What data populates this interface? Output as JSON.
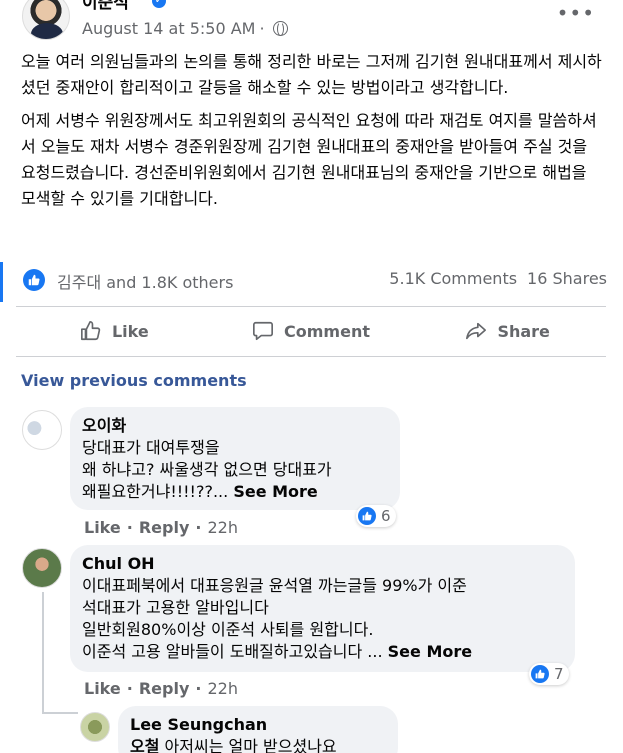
{
  "post": {
    "author": "이준석",
    "verified_mark": "✓",
    "timestamp": "August 14 at 5:50 AM",
    "separator": "·",
    "more_label": "•••",
    "paragraphs": [
      "오늘 여러 의원님들과의 논의를 통해 정리한 바로는 그저께 김기현 원내대표께서 제시하셨던 중재안이 합리적이고 갈등을 해소할 수 있는 방법이라고 생각합니다.",
      "어제 서병수 위원장께서도 최고위원회의 공식적인 요청에 따라 재검토 여지를 말씀하셔서 오늘도 재차 서병수 경준위원장께 김기현 원내대표의 중재안을 받아들여 주실 것을 요청드렸습니다. 경선준비위원회에서 김기현 원내대표님의 중재안을 기반으로 해법을 모색할 수 있기를 기대합니다."
    ],
    "reactors": "김주대 and 1.8K others",
    "comments_count": "5.1K Comments",
    "shares_count": "16 Shares"
  },
  "actions": {
    "like": "Like",
    "comment": "Comment",
    "share": "Share"
  },
  "view_previous": "View previous comments",
  "comments": [
    {
      "name": "오이화",
      "text": "당대표가 대여투쟁을\n왜 하냐고? 싸울생각 없으면 당대표가\n왜필요한거냐!!!!??...",
      "see_more": "See More",
      "like": "Like",
      "reply": "Reply",
      "time": "22h",
      "reactions": "6"
    },
    {
      "name": "Chul OH",
      "text": "이대표페북에서 대표응원글 윤석열 까는글들 99%가 이준\n석대표가 고용한 알바입니다\n일반회원80%이상 이준석 사퇴를 원합니다.\n이준석 고용 알바들이 도배질하고있습니다 ...",
      "see_more": "See More",
      "like": "Like",
      "reply": "Reply",
      "time": "22h",
      "reactions": "7"
    },
    {
      "name": "Lee Seungchan",
      "tag": "오철",
      "text": "아저씨는 얼마 받으셨나요"
    }
  ],
  "colors": {
    "accent": "#1877f2",
    "link": "#385898",
    "muted": "#65676b",
    "bubble": "#f0f2f5"
  }
}
